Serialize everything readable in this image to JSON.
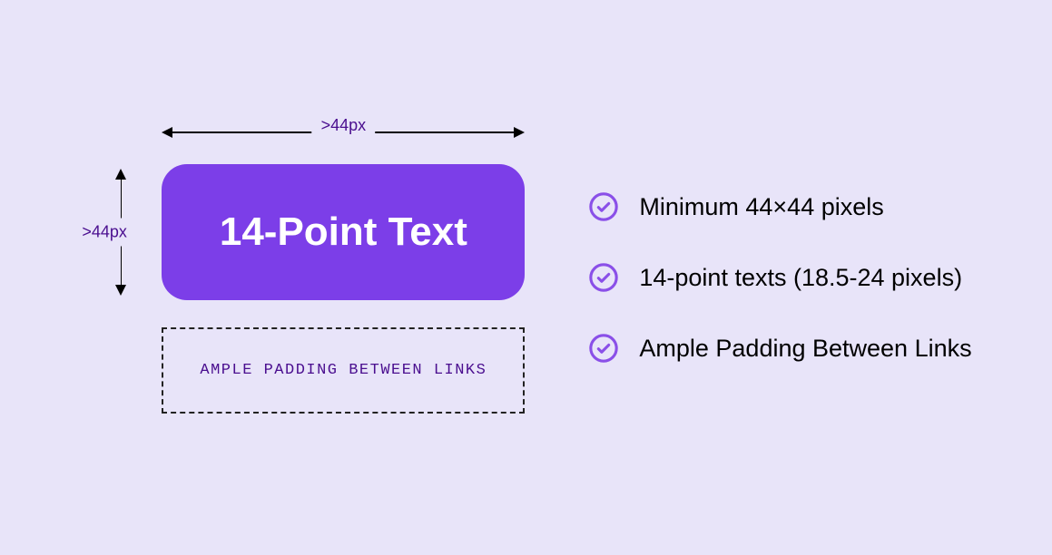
{
  "diagram": {
    "horizontal_label": ">44px",
    "vertical_label": ">44px",
    "button_text": "14-Point Text",
    "dashed_box_text": "AMPLE PADDING BETWEEN LINKS"
  },
  "checklist": {
    "items": [
      {
        "text": "Minimum 44×44 pixels"
      },
      {
        "text": "14-point texts (18.5-24 pixels)"
      },
      {
        "text": "Ample Padding Between Links"
      }
    ]
  },
  "colors": {
    "background": "#E8E4F9",
    "button": "#7C3EE8",
    "accent": "#8A4FE8",
    "label": "#4A0E8F"
  }
}
